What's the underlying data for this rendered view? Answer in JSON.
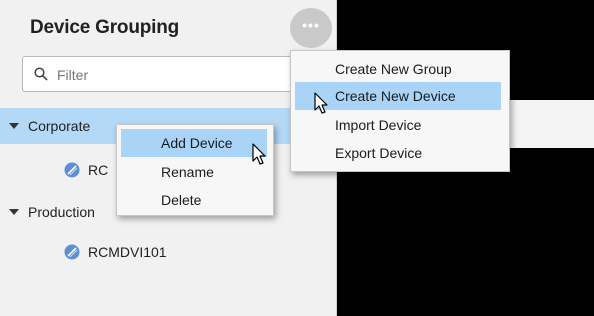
{
  "panel": {
    "title": "Device Grouping",
    "more_button": "•••",
    "filter_placeholder": "Filter"
  },
  "tree": {
    "items": [
      {
        "label": "Corporate",
        "type": "group",
        "expanded": true,
        "selected": true
      },
      {
        "label": "RC",
        "type": "device"
      },
      {
        "label": "Production",
        "type": "group",
        "expanded": true
      },
      {
        "label": "RCMDVI101",
        "type": "device"
      }
    ]
  },
  "group_menu": {
    "items": [
      {
        "label": "Create New Group"
      },
      {
        "label": "Create New Device",
        "highlighted": true
      },
      {
        "label": "Import Device"
      },
      {
        "label": "Export Device"
      }
    ]
  },
  "node_menu": {
    "items": [
      {
        "label": "Add Device",
        "highlighted": true
      },
      {
        "label": "Rename"
      },
      {
        "label": "Delete"
      }
    ]
  },
  "colors": {
    "selection": "#b3d9f7",
    "menu_highlight": "#a9d4f7",
    "device_icon": "#5b8fd6"
  },
  "icons": [
    "search-icon",
    "more-icon",
    "caret-down-icon",
    "device-icon",
    "mouse-pointer-icon"
  ]
}
